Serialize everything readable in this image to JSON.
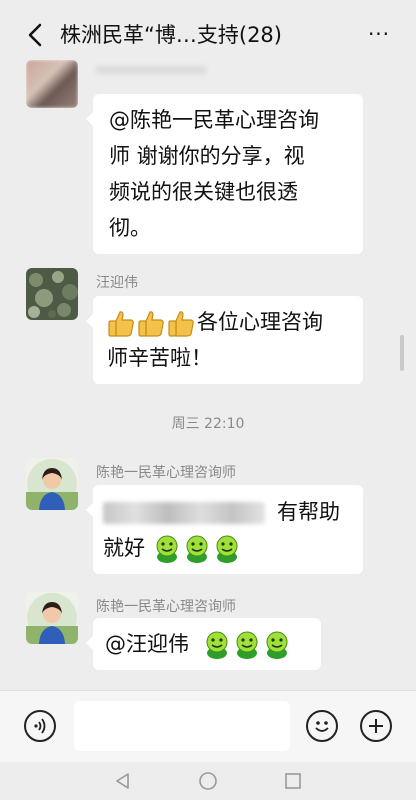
{
  "header": {
    "title": "株洲民革“博…支持(28)",
    "more": "···"
  },
  "messages": [
    {
      "text": "@陈艳一民革心理咨询师  谢谢你的分享，视频说的很关键也很透彻。",
      "lines": [
        "@陈艳一民革心理咨询",
        "师  谢谢你的分享，视",
        "频说的很关键也很透",
        "彻。"
      ]
    },
    {
      "sender": "汪迎伟",
      "text": "各位心理咨询师辛苦啦！",
      "lines": [
        "各位心理咨询",
        "师辛苦啦！"
      ]
    },
    {
      "timestamp": "周三 22:10"
    },
    {
      "sender": "陈艳一民革心理咨询师",
      "text_suffix": "有帮助",
      "line2": "就好"
    },
    {
      "sender": "陈艳一民革心理咨询师",
      "text": "@汪迎伟"
    }
  ],
  "icons": {
    "back": "back-arrow-icon",
    "voice": "voice-icon",
    "emoji": "emoji-icon",
    "add": "add-icon",
    "thumbs": "thumbs-up-icon",
    "green": "green-smiley-icon"
  }
}
